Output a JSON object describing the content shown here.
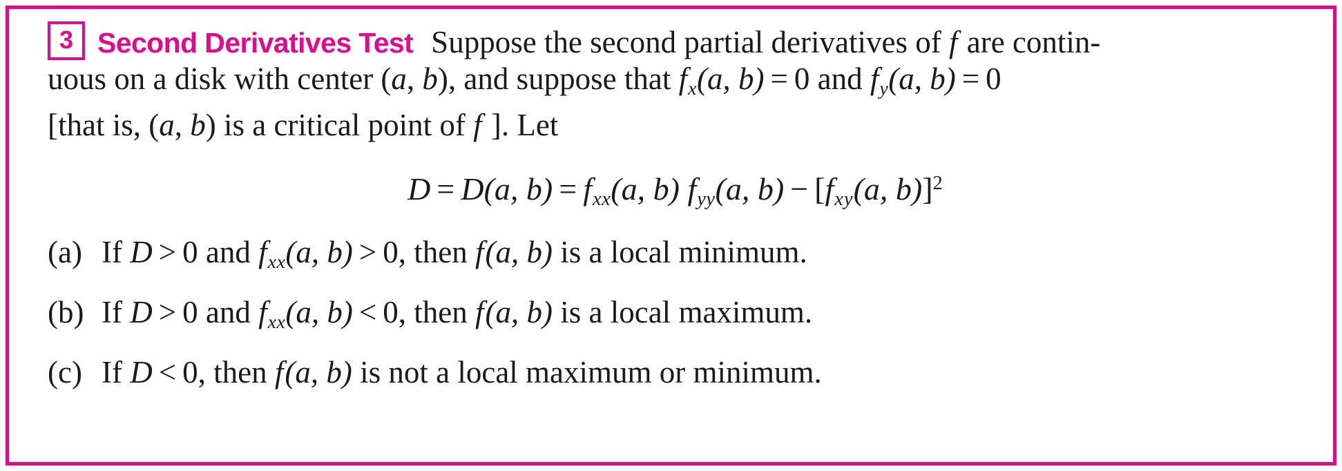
{
  "theme": {
    "accent_color": "#e20a8c",
    "text_color": "#1a1a1a",
    "background_color": "#ffffff"
  },
  "header": {
    "number": "3",
    "title": "Second Derivatives Test"
  },
  "statement": {
    "line1_a": "Suppose the second partial derivatives of",
    "line1_f": "f",
    "line1_b": "are contin-",
    "line2_a": "uous on a disk with center (",
    "line2_a_var": "a",
    "line2_comma": ", ",
    "line2_b_var": "b",
    "line2_b": "), and suppose that",
    "line2_fx": "f",
    "line2_fx_sub": "x",
    "line2_fx_args": "(a, b)",
    "line2_eq": "=",
    "line2_zero": "0",
    "line2_and": "and",
    "line2_fy": "f",
    "line2_fy_sub": "y",
    "line2_fy_args": "(a, b)",
    "line2_eq2": "=",
    "line2_zero2": "0",
    "line3_a": "[that is, (",
    "line3_a_var": "a",
    "line3_b_var": "b",
    "line3_b": ") is a critical point of",
    "line3_f": "f",
    "line3_c": "]. Let"
  },
  "equation": {
    "lhs": "D",
    "eq1": "=",
    "d_fn": "D",
    "d_args": "(a, b)",
    "eq2": "=",
    "fxx": "f",
    "fxx_sub": "xx",
    "fxx_args": "(a, b)",
    "fyy": "f",
    "fyy_sub": "yy",
    "fyy_args": "(a, b)",
    "minus": "−",
    "bracket_open": "[",
    "fxy": "f",
    "fxy_sub": "xy",
    "fxy_args": "(a, b)",
    "bracket_close": "]",
    "power": "2",
    "plain": "D = D(a, b) = fxx(a, b) fyy(a, b) − [fxy(a, b)]²"
  },
  "items": [
    {
      "label": "(a)",
      "if_word": "If",
      "d_var": "D",
      "rel1": ">",
      "val1": "0",
      "and_word": "and",
      "f_name": "f",
      "f_sub": "xx",
      "f_args": "(a, b)",
      "rel2": ">",
      "val2": "0,",
      "then_word": "then",
      "result_f": "f",
      "result_args": "(a, b)",
      "conclusion": "is a local minimum.",
      "plain": "(a) If D > 0 and fxx(a, b) > 0, then f(a, b) is a local minimum."
    },
    {
      "label": "(b)",
      "if_word": "If",
      "d_var": "D",
      "rel1": ">",
      "val1": "0",
      "and_word": "and",
      "f_name": "f",
      "f_sub": "xx",
      "f_args": "(a, b)",
      "rel2": "<",
      "val2": "0,",
      "then_word": "then",
      "result_f": "f",
      "result_args": "(a, b)",
      "conclusion": "is a local maximum.",
      "plain": "(b) If D > 0 and fxx(a, b) < 0, then f(a, b) is a local maximum."
    },
    {
      "label": "(c)",
      "if_word": "If",
      "d_var": "D",
      "rel1": "<",
      "val1": "0,",
      "then_word": "then",
      "result_f": "f",
      "result_args": "(a, b)",
      "conclusion": "is not a local maximum or minimum.",
      "plain": "(c) If D < 0, then f(a, b) is not a local maximum or minimum."
    }
  ]
}
